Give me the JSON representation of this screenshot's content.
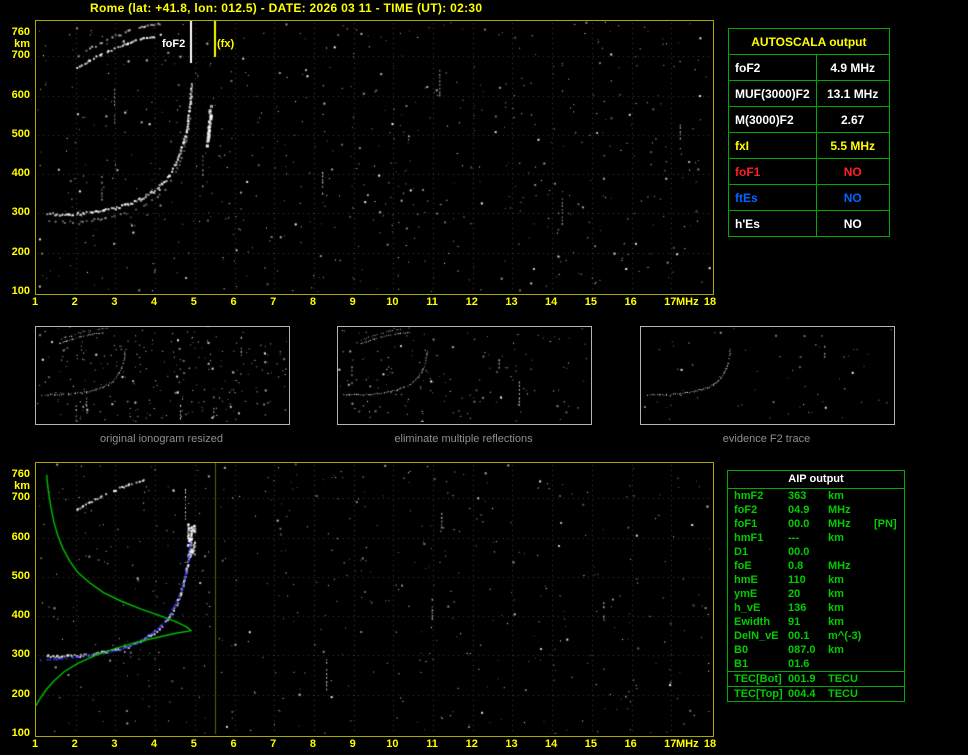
{
  "title": "Rome (lat: +41.8, lon: 012.5) - DATE: 2026 03 11 - TIME (UT): 02:30",
  "colors": {
    "background": "#000000",
    "axis_text": "#ffff00",
    "plot_border": "#a8a800",
    "grid": "#3c3c3c",
    "trace_white": "#ffffff",
    "green": "#00c000",
    "blue_trace": "#3333ff",
    "caption_gray": "#8f8f8f",
    "table_border": "#00aa00",
    "red": "#ff2020",
    "blue": "#0066ff",
    "yellow": "#ffff00"
  },
  "axes": {
    "y_unit": "km",
    "x_unit": "MHz",
    "y_ticks": [
      760,
      700,
      600,
      500,
      400,
      300,
      200,
      100
    ],
    "x_ticks": [
      1,
      2,
      3,
      4,
      5,
      6,
      7,
      8,
      9,
      10,
      11,
      12,
      13,
      14,
      15,
      16,
      17,
      18
    ]
  },
  "top_plot": {
    "foF2_label": "foF2",
    "fx_label": "(fx)"
  },
  "autoscala": {
    "header": "AUTOSCALA output",
    "rows": [
      {
        "label": "foF2",
        "value": "4.9 MHz",
        "color": "#ffffff"
      },
      {
        "label": "MUF(3000)F2",
        "value": "13.1 MHz",
        "color": "#ffffff"
      },
      {
        "label": "M(3000)F2",
        "value": "2.67",
        "color": "#ffffff"
      },
      {
        "label": "fxI",
        "value": "5.5 MHz",
        "color": "#ffff00"
      },
      {
        "label": "foF1",
        "value": "NO",
        "color": "#ff2020"
      },
      {
        "label": "ftEs",
        "value": "NO",
        "color": "#0066ff"
      },
      {
        "label": "h'Es",
        "value": "NO",
        "color": "#ffffff"
      }
    ]
  },
  "thumbnails": [
    {
      "caption": "original ionogram resized"
    },
    {
      "caption": "eliminate multiple reflections"
    },
    {
      "caption": "evidence F2 trace"
    }
  ],
  "aip": {
    "header": "AIP output",
    "rows": [
      {
        "name": "hmF2",
        "value": "363",
        "unit": "km",
        "note": "",
        "sep": false
      },
      {
        "name": "foF2",
        "value": "04.9",
        "unit": "MHz",
        "note": "",
        "sep": false
      },
      {
        "name": "foF1",
        "value": "00.0",
        "unit": "MHz",
        "note": "[PN]",
        "sep": false
      },
      {
        "name": "hmF1",
        "value": "---",
        "unit": "km",
        "note": "",
        "sep": false
      },
      {
        "name": "D1",
        "value": "00.0",
        "unit": "",
        "note": "",
        "sep": false
      },
      {
        "name": "foE",
        "value": "0.8",
        "unit": "MHz",
        "note": "",
        "sep": false
      },
      {
        "name": "hmE",
        "value": "110",
        "unit": "km",
        "note": "",
        "sep": false
      },
      {
        "name": "ymE",
        "value": "20",
        "unit": "km",
        "note": "",
        "sep": false
      },
      {
        "name": "h_vE",
        "value": "136",
        "unit": "km",
        "note": "",
        "sep": false
      },
      {
        "name": "Ewidth",
        "value": "91",
        "unit": "km",
        "note": "",
        "sep": false
      },
      {
        "name": "DelN_vE",
        "value": "00.1",
        "unit": "m^(-3)",
        "note": "",
        "sep": false
      },
      {
        "name": "B0",
        "value": "087.0",
        "unit": "km",
        "note": "",
        "sep": false
      },
      {
        "name": "B1",
        "value": "01.6",
        "unit": "",
        "note": "",
        "sep": false
      },
      {
        "name": "TEC[Bot]",
        "value": "001.9",
        "unit": "TECU",
        "note": "",
        "sep": true
      },
      {
        "name": "TEC[Top]",
        "value": "004.4",
        "unit": "TECU",
        "note": "",
        "sep": true
      }
    ]
  },
  "chart_data": [
    {
      "type": "scatter",
      "title": "ionogram (autoscaled)",
      "xlabel": "MHz",
      "ylabel": "km",
      "xlim": [
        1,
        18
      ],
      "ylim": [
        100,
        760
      ],
      "y_top_draw_km": 790,
      "markers": {
        "foF2_MHz": 4.9,
        "fxI_MHz": 5.5
      },
      "f2_trace_f_h": [
        [
          1.25,
          302
        ],
        [
          1.5,
          300
        ],
        [
          1.8,
          300
        ],
        [
          2.1,
          302
        ],
        [
          2.4,
          305
        ],
        [
          2.7,
          310
        ],
        [
          3.0,
          316
        ],
        [
          3.3,
          325
        ],
        [
          3.6,
          338
        ],
        [
          3.9,
          355
        ],
        [
          4.15,
          375
        ],
        [
          4.35,
          400
        ],
        [
          4.5,
          428
        ],
        [
          4.62,
          458
        ],
        [
          4.72,
          492
        ],
        [
          4.8,
          530
        ],
        [
          4.85,
          565
        ],
        [
          4.88,
          600
        ],
        [
          4.9,
          632
        ]
      ],
      "second_hop_trace_f_h": [
        [
          2.0,
          672
        ],
        [
          2.3,
          690
        ],
        [
          2.6,
          706
        ],
        [
          2.95,
          722
        ],
        [
          3.3,
          736
        ],
        [
          3.7,
          748
        ],
        [
          4.1,
          756
        ]
      ],
      "x_mode_trace_f_h": [
        [
          5.28,
          470
        ],
        [
          5.32,
          505
        ],
        [
          5.35,
          540
        ],
        [
          5.37,
          575
        ]
      ],
      "noise": {
        "seed": 7,
        "count": 620,
        "columns": 7
      }
    },
    {
      "type": "scatter",
      "title": "ionogram with restored trace (blue) and electron density profile (green)",
      "xlabel": "MHz",
      "ylabel": "km",
      "xlim": [
        1,
        18
      ],
      "ylim": [
        100,
        760
      ],
      "y_top_draw_km": 790,
      "marker_fxI_MHz": 5.5,
      "f2_trace_f_h": [
        [
          1.25,
          302
        ],
        [
          1.5,
          300
        ],
        [
          1.8,
          300
        ],
        [
          2.1,
          302
        ],
        [
          2.4,
          305
        ],
        [
          2.7,
          310
        ],
        [
          3.0,
          316
        ],
        [
          3.3,
          325
        ],
        [
          3.6,
          338
        ],
        [
          3.9,
          355
        ],
        [
          4.15,
          375
        ],
        [
          4.35,
          400
        ],
        [
          4.5,
          428
        ],
        [
          4.62,
          458
        ],
        [
          4.72,
          492
        ],
        [
          4.8,
          530
        ],
        [
          4.85,
          565
        ],
        [
          4.88,
          600
        ],
        [
          4.9,
          632
        ]
      ],
      "second_hop_trace_f_h": [
        [
          2.0,
          672
        ],
        [
          2.3,
          690
        ],
        [
          2.6,
          706
        ],
        [
          2.95,
          722
        ],
        [
          3.3,
          736
        ],
        [
          3.7,
          748
        ]
      ],
      "restored_trace_blue_f_h": [
        [
          1.1,
          290
        ],
        [
          1.5,
          292
        ],
        [
          1.9,
          296
        ],
        [
          2.3,
          301
        ],
        [
          2.7,
          308
        ],
        [
          3.1,
          318
        ],
        [
          3.5,
          332
        ],
        [
          3.8,
          350
        ],
        [
          4.05,
          370
        ],
        [
          4.3,
          398
        ],
        [
          4.5,
          432
        ],
        [
          4.65,
          470
        ],
        [
          4.75,
          510
        ],
        [
          4.82,
          550
        ],
        [
          4.87,
          588
        ]
      ],
      "density_profile_green_f_h": [
        [
          1.0,
          172
        ],
        [
          1.1,
          190
        ],
        [
          1.25,
          212
        ],
        [
          1.45,
          235
        ],
        [
          1.7,
          258
        ],
        [
          2.05,
          280
        ],
        [
          2.5,
          300
        ],
        [
          3.0,
          318
        ],
        [
          3.55,
          334
        ],
        [
          4.1,
          347
        ],
        [
          4.55,
          357
        ],
        [
          4.85,
          362
        ],
        [
          4.9,
          363
        ],
        [
          4.8,
          372
        ],
        [
          4.55,
          385
        ],
        [
          4.15,
          400
        ],
        [
          3.65,
          418
        ],
        [
          3.15,
          438
        ],
        [
          2.7,
          460
        ],
        [
          2.35,
          485
        ],
        [
          2.05,
          512
        ],
        [
          1.85,
          540
        ],
        [
          1.68,
          572
        ],
        [
          1.55,
          605
        ],
        [
          1.45,
          640
        ],
        [
          1.38,
          675
        ],
        [
          1.32,
          712
        ],
        [
          1.28,
          745
        ],
        [
          1.27,
          760
        ]
      ],
      "noise": {
        "seed": 13,
        "count": 470,
        "columns": 6
      }
    },
    {
      "type": "scatter",
      "title": "processing-step thumbnails",
      "xlim": [
        1,
        12
      ],
      "ylim": [
        100,
        760
      ],
      "y_top_draw_km": 790,
      "panels": [
        {
          "noise_count": 260,
          "columns": 5,
          "show_second_hop": true,
          "seed": 21
        },
        {
          "noise_count": 150,
          "columns": 3,
          "show_second_hop": true,
          "seed": 22
        },
        {
          "noise_count": 60,
          "columns": 1,
          "show_second_hop": false,
          "seed": 23
        }
      ]
    }
  ]
}
